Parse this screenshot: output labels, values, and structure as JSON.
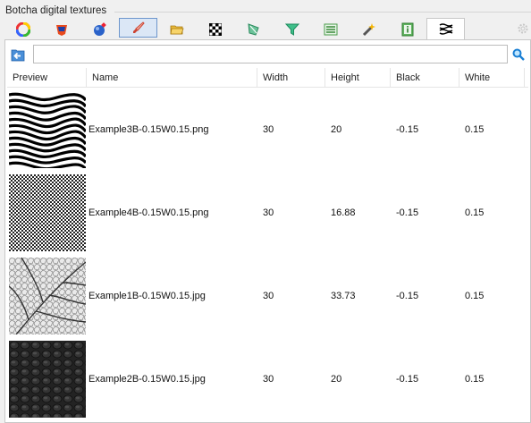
{
  "group_title": "Botcha digital textures",
  "tabs": [
    {
      "icon": "color-wheel-icon"
    },
    {
      "icon": "paint-bucket-icon"
    },
    {
      "icon": "globe-brush-icon"
    },
    {
      "icon": "brush-icon"
    },
    {
      "icon": "folder-icon"
    },
    {
      "icon": "checker-icon"
    },
    {
      "icon": "shape-icon"
    },
    {
      "icon": "filter-icon"
    },
    {
      "icon": "list-icon"
    },
    {
      "icon": "wand-icon"
    },
    {
      "icon": "info-icon"
    },
    {
      "icon": "texture-icon"
    }
  ],
  "path": {
    "value": "",
    "placeholder": ""
  },
  "columns": {
    "preview": "Preview",
    "name": "Name",
    "width": "Width",
    "height": "Height",
    "black": "Black",
    "white": "White"
  },
  "rows": [
    {
      "name": "Example3B-0.15W0.15.png",
      "width": "30",
      "height": "20",
      "black": "-0.15",
      "white": "0.15",
      "preview": "wavy-stripes"
    },
    {
      "name": "Example4B-0.15W0.15.png",
      "width": "30",
      "height": "16.88",
      "black": "-0.15",
      "white": "0.15",
      "preview": "checker"
    },
    {
      "name": "Example1B-0.15W0.15.jpg",
      "width": "30",
      "height": "33.73",
      "black": "-0.15",
      "white": "0.15",
      "preview": "leaf-veins"
    },
    {
      "name": "Example2B-0.15W0.15.jpg",
      "width": "30",
      "height": "20",
      "black": "-0.15",
      "white": "0.15",
      "preview": "dark-cells"
    }
  ]
}
